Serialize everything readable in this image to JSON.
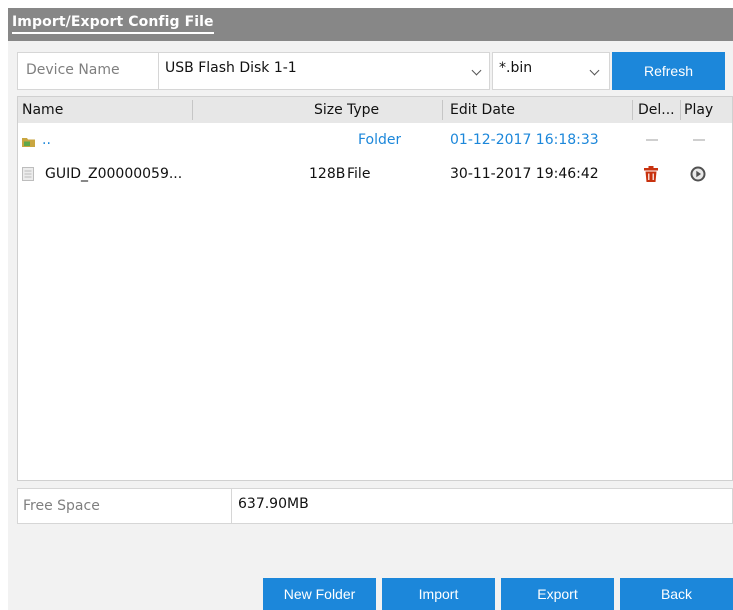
{
  "window": {
    "title": "Import/Export Config File"
  },
  "toolbar": {
    "device_label": "Device Name",
    "device_value": "USB Flash Disk 1-1",
    "filter_value": "*.bin",
    "refresh_label": "Refresh"
  },
  "table": {
    "headers": {
      "name": "Name",
      "size": "Size",
      "type": "Type",
      "edit_date": "Edit Date",
      "delete": "Del...",
      "play": "Play"
    },
    "rows": [
      {
        "name": "..",
        "size": "",
        "type": "Folder",
        "edit_date": "01-12-2017 16:18:33",
        "icon": "folder-up-icon"
      },
      {
        "name": "GUID_Z00000059...",
        "size": "128B",
        "type": "File",
        "edit_date": "30-11-2017 19:46:42",
        "icon": "file-icon"
      }
    ]
  },
  "footer": {
    "free_space_label": "Free Space",
    "free_space_value": "637.90MB"
  },
  "buttons": {
    "new_folder": "New Folder",
    "import": "Import",
    "export": "Export",
    "back": "Back"
  },
  "colors": {
    "accent": "#1c87da",
    "title_bar": "#878787",
    "delete_icon": "#c8320f"
  }
}
